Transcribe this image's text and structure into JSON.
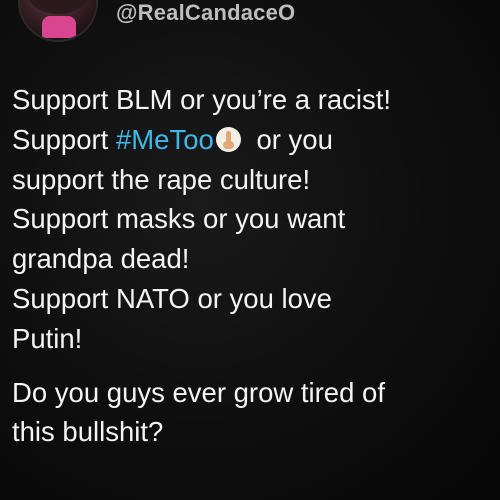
{
  "profile": {
    "handle": "@RealCandaceO"
  },
  "tweet": {
    "lines": [
      "Support BLM or you’re a racist!",
      "Support ",
      "#MeToo",
      " or you",
      "support the rape culture!",
      "Support masks or you want",
      "grandpa dead!",
      "Support NATO or you love",
      "Putin!"
    ],
    "closing_lines": [
      "Do you guys ever grow tired of",
      "this bullshit?"
    ],
    "emoji": "raised-fist-emoji"
  },
  "colors": {
    "background": "#0d0d0d",
    "text": "#f4f4f4",
    "handle": "#bdbdbd",
    "hashtag": "#3fb8e6"
  }
}
